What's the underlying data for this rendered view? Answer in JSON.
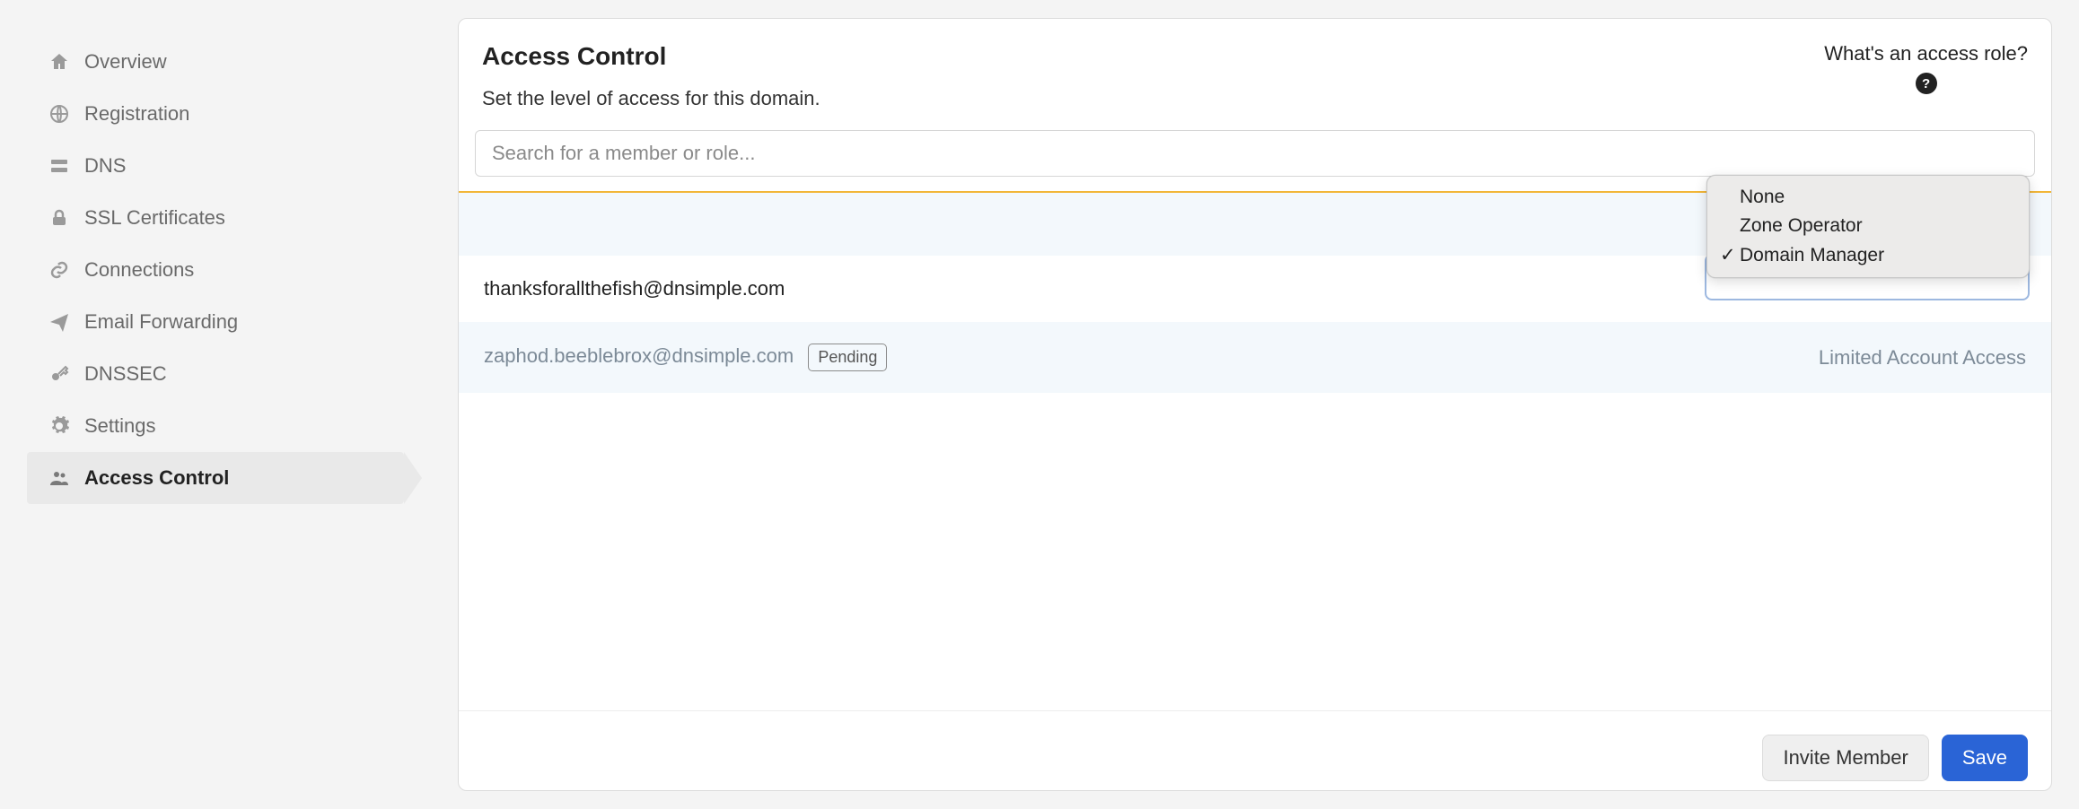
{
  "sidebar": {
    "items": [
      {
        "label": "Overview"
      },
      {
        "label": "Registration"
      },
      {
        "label": "DNS"
      },
      {
        "label": "SSL Certificates"
      },
      {
        "label": "Connections"
      },
      {
        "label": "Email Forwarding"
      },
      {
        "label": "DNSSEC"
      },
      {
        "label": "Settings"
      },
      {
        "label": "Access Control"
      }
    ]
  },
  "header": {
    "title": "Access Control",
    "subtitle": "Set the level of access for this domain.",
    "help_label": "What's an access role?"
  },
  "search": {
    "placeholder": "Search for a member or role..."
  },
  "dropdown": {
    "options": [
      {
        "label": "None",
        "selected": false
      },
      {
        "label": "Zone Operator",
        "selected": false
      },
      {
        "label": "Domain Manager",
        "selected": true
      }
    ]
  },
  "members": [
    {
      "email": "thanksforallthefish@dnsimple.com",
      "badge": null,
      "role": null,
      "shaded": false
    },
    {
      "email": "zaphod.beeblebrox@dnsimple.com",
      "badge": "Pending",
      "role": "Limited Account Access",
      "shaded": true
    }
  ],
  "footer": {
    "invite_label": "Invite Member",
    "save_label": "Save"
  }
}
